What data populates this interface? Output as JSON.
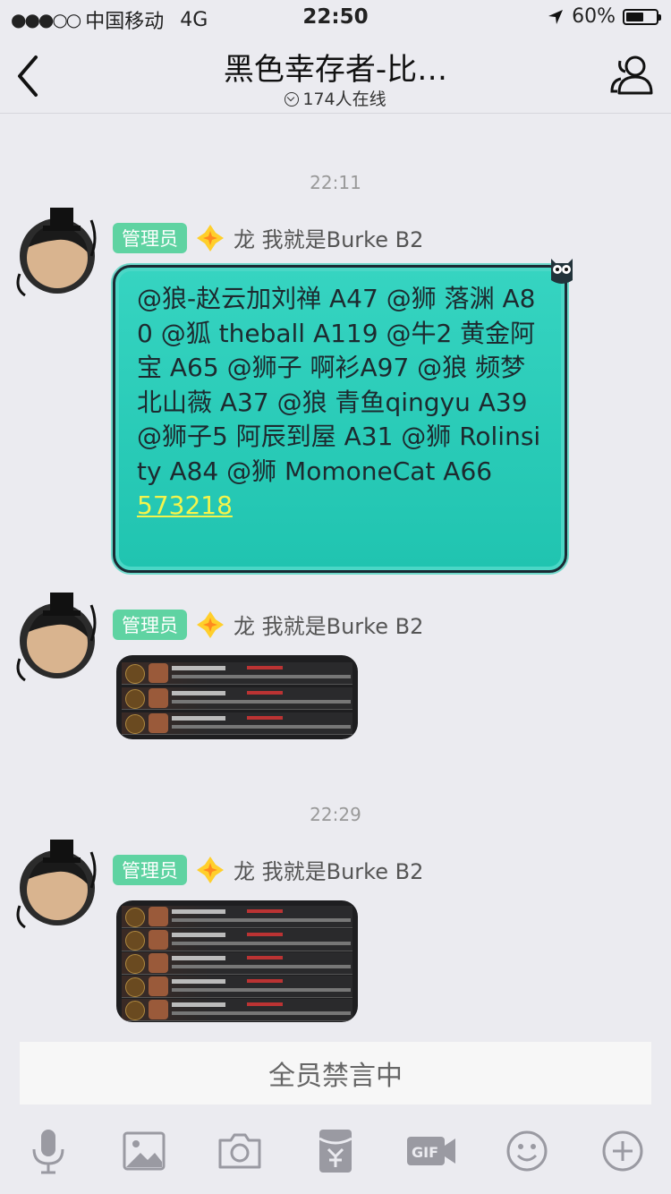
{
  "status": {
    "carrier": "中国移动",
    "network": "4G",
    "time": "22:50",
    "battery": "60%",
    "battery_level": 0.6
  },
  "header": {
    "title": "黑色幸存者-比…",
    "online": "174人在线"
  },
  "messages": [
    {
      "timestamp": "22:11",
      "badge": "管理员",
      "sender": "龙 我就是Burke B2",
      "text": "@狼-赵云加刘禅 A47 @狮 落渊 A80 @狐 theball A119 @牛2 黄金阿宝 A65 @狮子 啊衫A97 @狼 频梦北山薇 A37 @狼 青鱼qingyu A39 @狮子5 阿辰到屋 A31 @狮 Rolinsity A84 @狮  MomoneCat A66",
      "code": "573218"
    },
    {
      "badge": "管理员",
      "sender": "龙 我就是Burke B2",
      "image": "result-screenshot-1"
    },
    {
      "timestamp": "22:29",
      "badge": "管理员",
      "sender": "龙 我就是Burke B2",
      "image": "result-screenshot-2"
    }
  ],
  "ban_notice": "全员禁言中",
  "toolbar": [
    "mic-icon",
    "image-icon",
    "camera-icon",
    "red-packet-icon",
    "gif-icon",
    "emoji-icon",
    "plus-icon"
  ],
  "colors": {
    "badge": "#5fd3a2",
    "bubble": "#22c6b2",
    "code": "#f4f44c"
  }
}
